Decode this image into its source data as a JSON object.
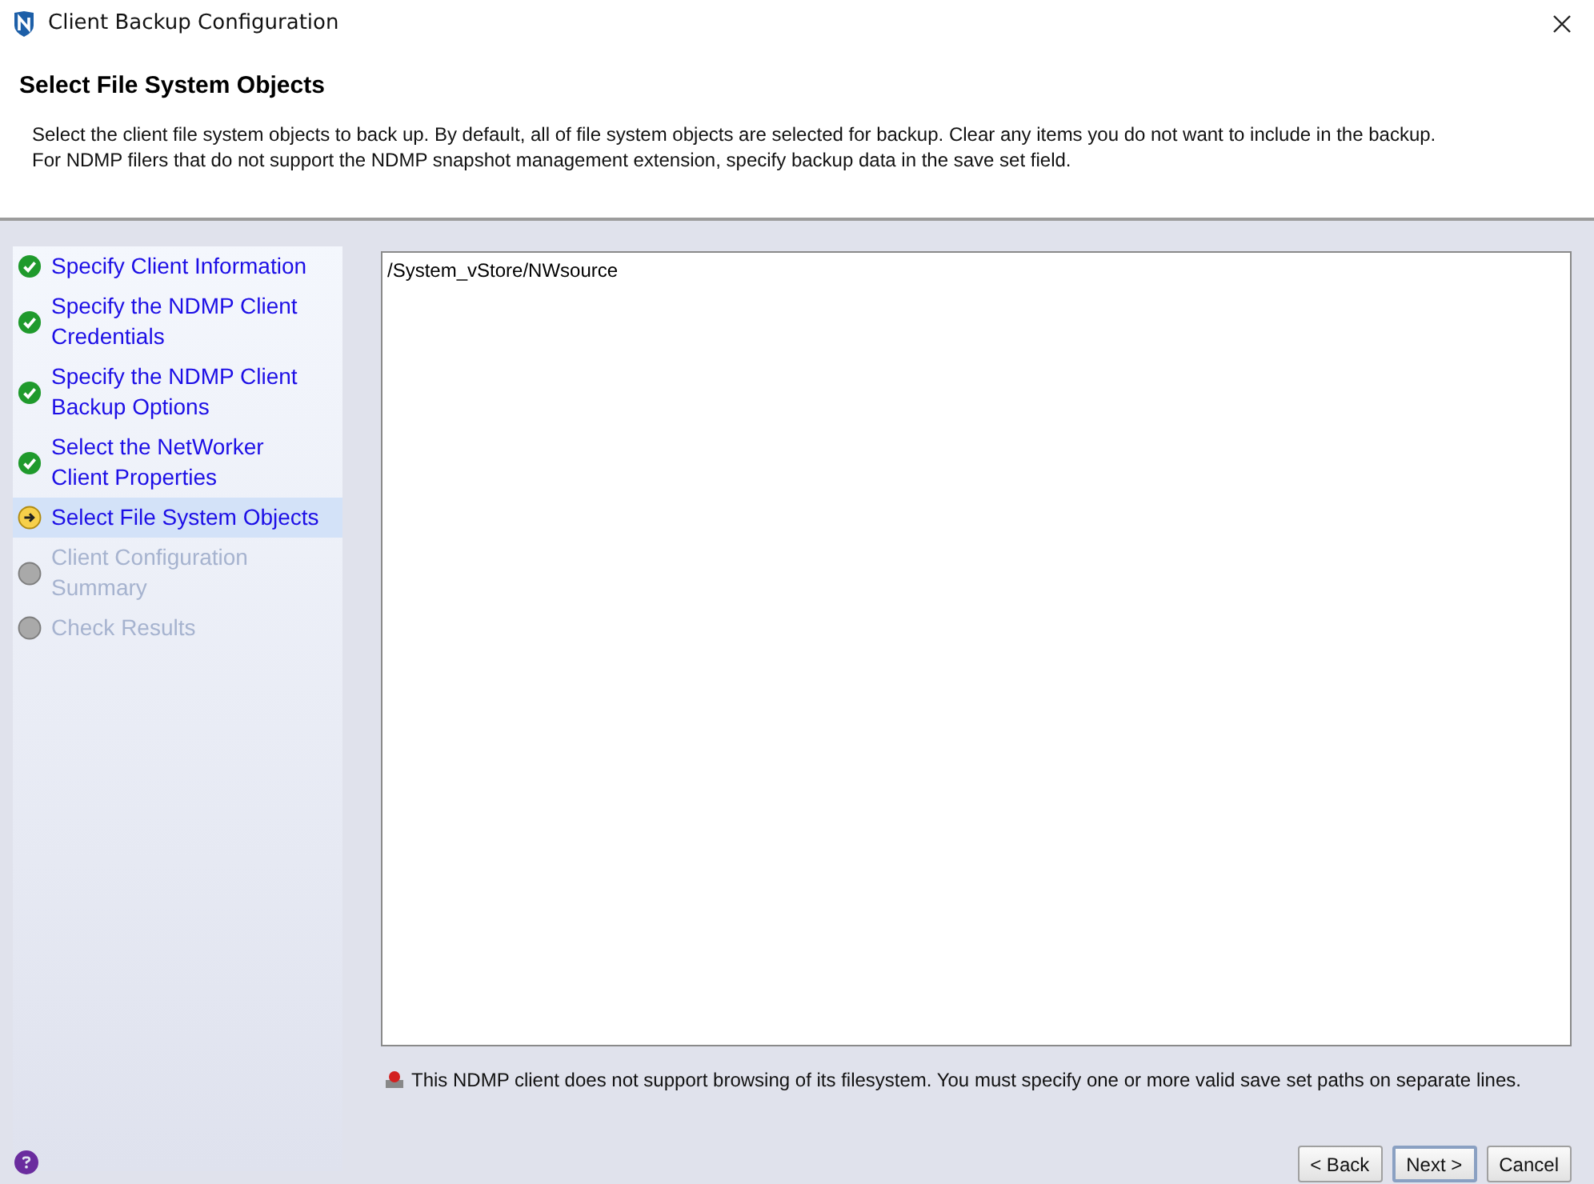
{
  "window": {
    "title": "Client Backup Configuration"
  },
  "header": {
    "title": "Select File System Objects",
    "description_lines": [
      "Select the client file system objects to back up. By default, all of file system objects are selected for backup. Clear any items you do not want to include in the backup.",
      "For NDMP filers that do not support the NDMP snapshot management extension, specify backup data in the save set field."
    ]
  },
  "steps": [
    {
      "label": "Specify Client Information",
      "kind": "done",
      "selected": false
    },
    {
      "label": "Specify the NDMP Client Credentials",
      "kind": "done",
      "selected": false
    },
    {
      "label": "Specify the NDMP Client Backup Options",
      "kind": "done",
      "selected": false
    },
    {
      "label": "Select the NetWorker Client Properties",
      "kind": "done",
      "selected": false
    },
    {
      "label": "Select File System Objects",
      "kind": "current",
      "selected": true
    },
    {
      "label": "Client Configuration Summary",
      "kind": "pending",
      "selected": false
    },
    {
      "label": "Check Results",
      "kind": "pending",
      "selected": false
    }
  ],
  "save_set_field": {
    "value": "/System_vStore/NWsource"
  },
  "warning": "This NDMP client does not support browsing of its filesystem. You must specify one or more valid save set paths on separate lines.",
  "buttons": [
    {
      "label": "< Back",
      "kind": "normal"
    },
    {
      "label": "Next >",
      "kind": "default"
    },
    {
      "label": "Cancel",
      "kind": "normal"
    }
  ]
}
